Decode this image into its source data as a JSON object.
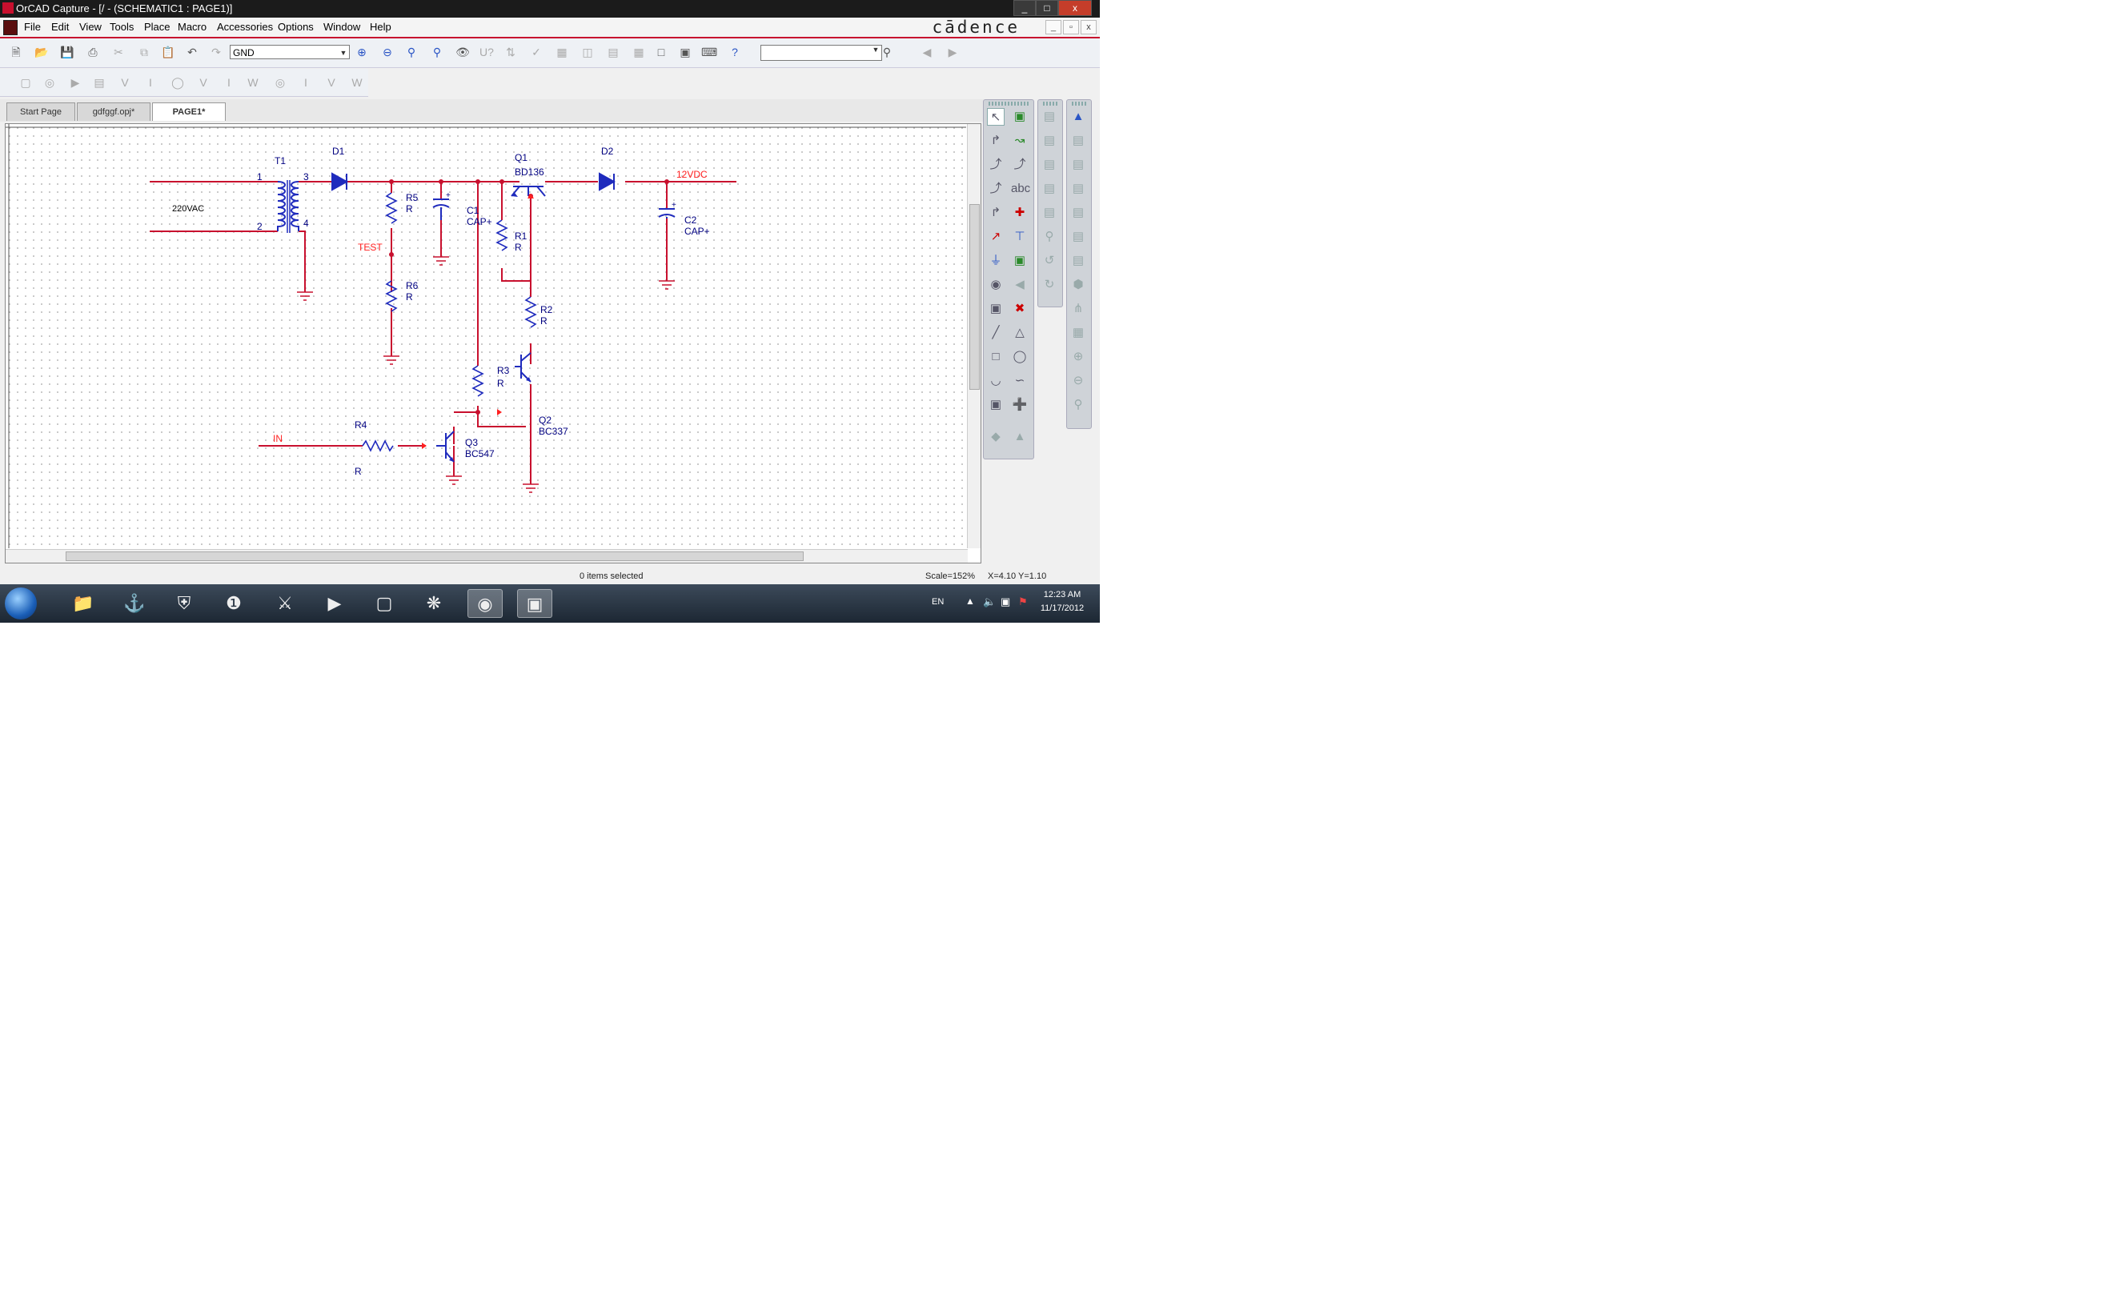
{
  "window": {
    "title": "OrCAD Capture - [/ - (SCHEMATIC1 : PAGE1)]",
    "brand": "cādence",
    "controls": {
      "minimize": "_",
      "restore": "□",
      "close": "x"
    },
    "mdi_controls": {
      "minimize": "_",
      "restore": "▫",
      "close": "x"
    }
  },
  "menu": [
    "File",
    "Edit",
    "View",
    "Tools",
    "Place",
    "Macro",
    "Accessories",
    "Options",
    "Window",
    "Help"
  ],
  "toolbar": {
    "part_selector_value": "GND",
    "search_value": ""
  },
  "tabs": [
    {
      "label": "Start Page",
      "active": false
    },
    {
      "label": "gdfggf.opj*",
      "active": false
    },
    {
      "label": "PAGE1*",
      "active": true
    }
  ],
  "schematic": {
    "labels": {
      "t1": "T1",
      "pin1": "1",
      "pin2": "2",
      "pin3": "3",
      "pin4": "4",
      "ac": "220VAC",
      "d1": "D1",
      "d2": "D2",
      "r5": "R5",
      "r5v": "R",
      "c1": "C1",
      "c1v": "CAP+",
      "test": "TEST",
      "r6": "R6",
      "r6v": "R",
      "q1": "Q1",
      "q1v": "BD136",
      "r1": "R1",
      "r1v": "R",
      "r2": "R2",
      "r2v": "R",
      "r3": "R3",
      "r3v": "R",
      "q2": "Q2",
      "q2v": "BC337",
      "q3": "Q3",
      "q3v": "BC547",
      "r4": "R4",
      "r4v": "R",
      "in": "IN",
      "out": "12VDC",
      "c2": "C2",
      "c2v": "CAP+",
      "plus1": "+",
      "plus2": "+"
    }
  },
  "status": {
    "selection": "0 items selected",
    "scale": "Scale=152%",
    "coords": "X=4.10  Y=1.10"
  },
  "taskbar": {
    "language": "EN",
    "time": "12:23 AM",
    "date": "11/17/2012"
  },
  "colors": {
    "wire": "#c8102e",
    "part": "#1f2bbd",
    "pin_text": "#000080",
    "net_label": "#ff2020",
    "titlebar": "#1b1b1b"
  }
}
